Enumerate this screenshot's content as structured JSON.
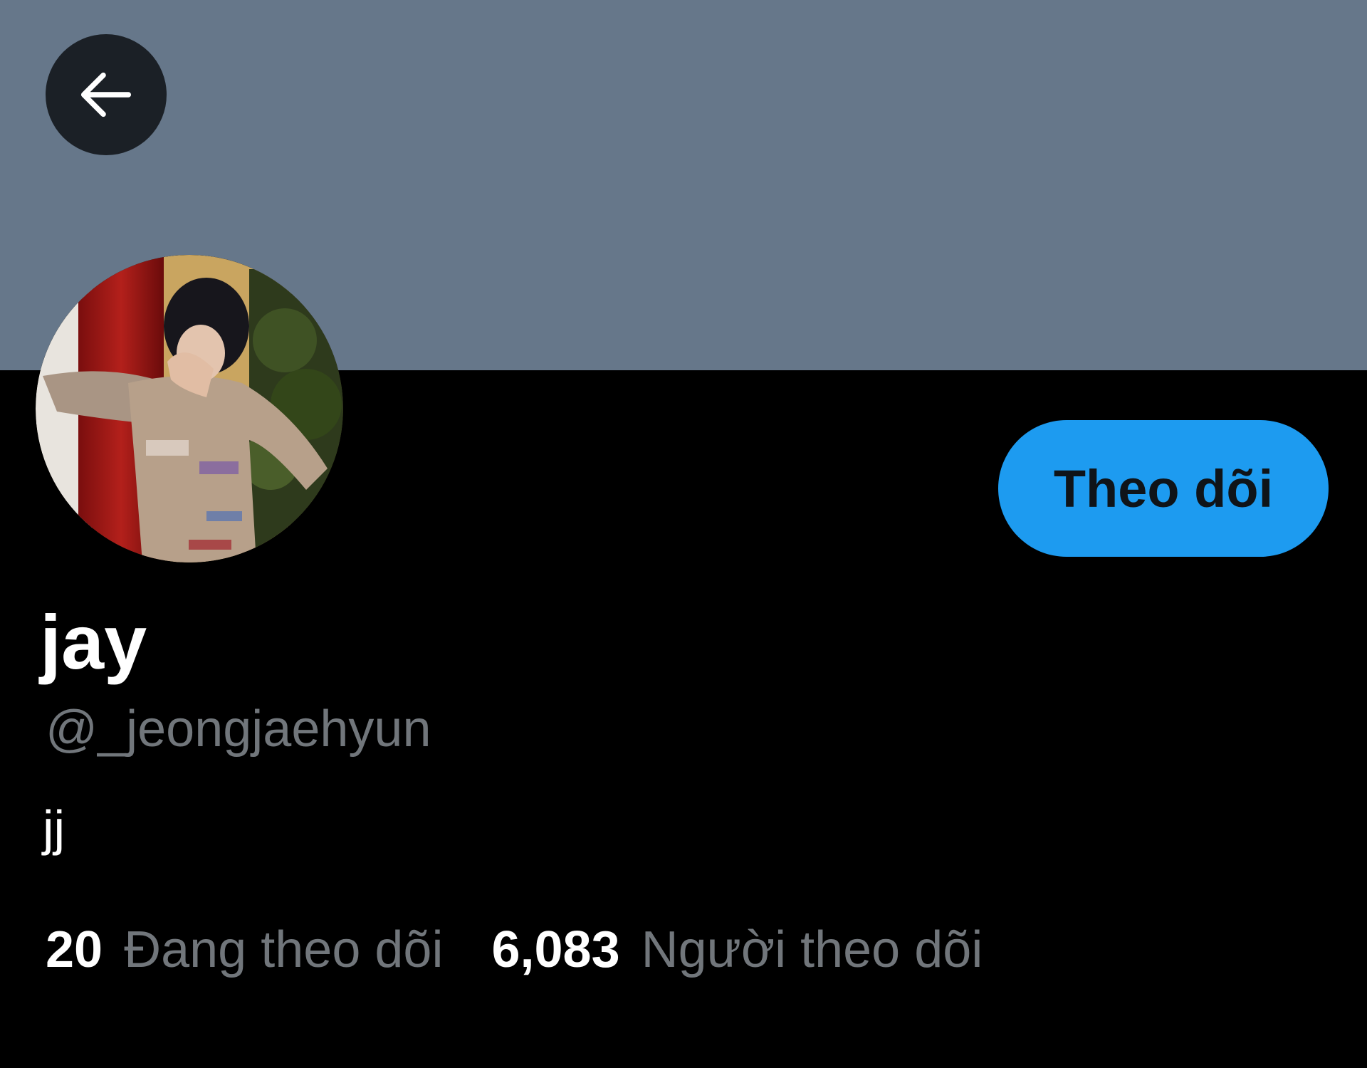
{
  "colors": {
    "banner": "#66778a",
    "background": "#000000",
    "accent": "#1d9bf0",
    "secondary_text": "#71767b",
    "primary_text": "#ffffff"
  },
  "header": {
    "back_icon": "arrow-left-icon"
  },
  "profile": {
    "display_name": "jay",
    "handle": "@_jeongjaehyun",
    "bio": "jj",
    "avatar": "profile-photo"
  },
  "actions": {
    "follow_label": "Theo dõi"
  },
  "stats": {
    "following_count": "20",
    "following_label": "Đang theo dõi",
    "followers_count": "6,083",
    "followers_label": "Người theo dõi"
  }
}
